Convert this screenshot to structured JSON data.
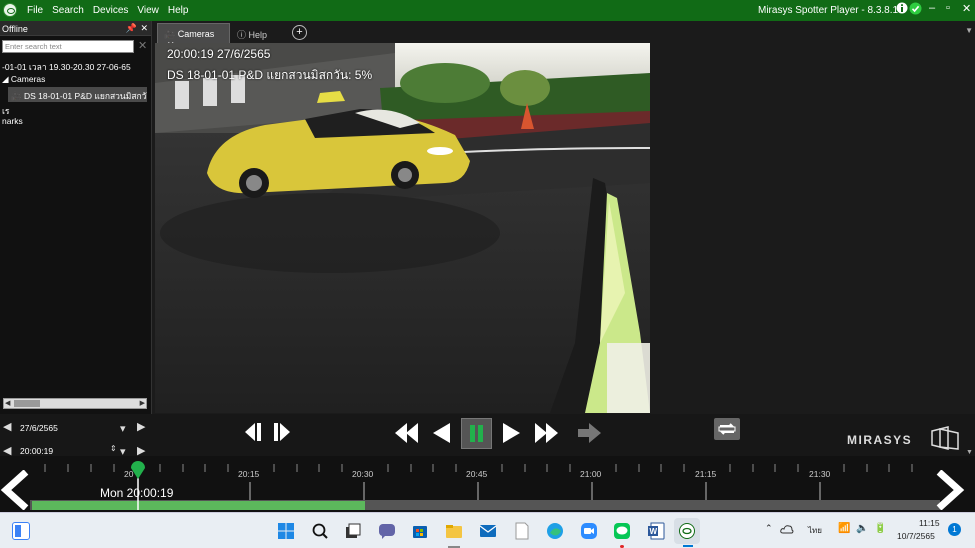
{
  "window": {
    "menu": [
      "File",
      "Search",
      "Devices",
      "View",
      "Help"
    ],
    "title": "Mirasys Spotter Player - 8.3.8.1"
  },
  "left_panel": {
    "title": "Offline",
    "search_placeholder": "Enter search text",
    "tree": {
      "item0": "-01-01 เวลา 19.30-20.30 27-06-65",
      "cameras": "Cameras",
      "selected": "DS 18-01-01 P&D แยกสวนมิสกวัน",
      "item3": "เร",
      "item4": "narks"
    }
  },
  "tabs": {
    "cameras": "Cameras",
    "help": "Help"
  },
  "video": {
    "timestamp": "20:00:19  27/6/2565",
    "camera_label": "DS 18-01-01 P&D แยกสวนมิสกวัน: 5%"
  },
  "controls": {
    "date": "27/6/2565",
    "time": "20:00:19",
    "logo": "MIRASYS"
  },
  "timeline": {
    "ticks": [
      "20:15",
      "20:30",
      "20:45",
      "21:00",
      "21:15",
      "21:30"
    ],
    "cursor_label": "Mon 20:00:19",
    "cursor_partial": "20"
  },
  "taskbar": {
    "lang": "ไทย",
    "time": "11:15",
    "date": "10/7/2565",
    "notif_count": "1"
  },
  "colors": {
    "title_bar": "#116b16",
    "accent_green": "#22b14c",
    "recorded_bar": "#5cb85c"
  }
}
